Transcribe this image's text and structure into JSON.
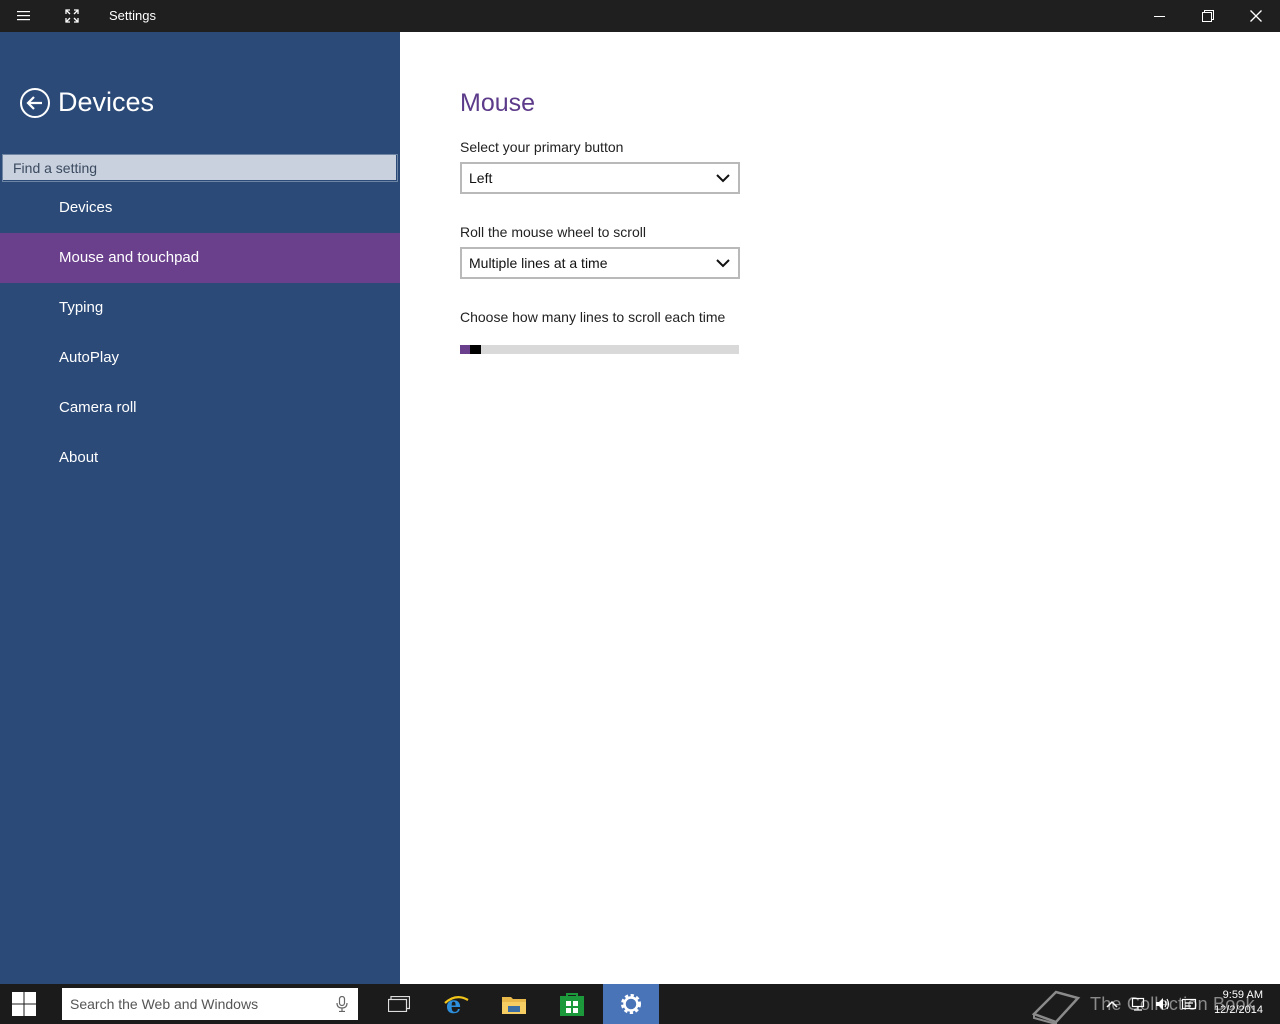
{
  "window": {
    "title": "Settings"
  },
  "sidebar": {
    "title": "Devices",
    "search_placeholder": "Find a setting",
    "items": [
      {
        "label": "Devices",
        "active": false
      },
      {
        "label": "Mouse and touchpad",
        "active": true
      },
      {
        "label": "Typing",
        "active": false
      },
      {
        "label": "AutoPlay",
        "active": false
      },
      {
        "label": "Camera roll",
        "active": false
      },
      {
        "label": "About",
        "active": false
      }
    ]
  },
  "main": {
    "title": "Mouse",
    "primary_button": {
      "label": "Select your primary button",
      "value": "Left"
    },
    "wheel_scroll": {
      "label": "Roll the mouse wheel to scroll",
      "value": "Multiple lines at a time"
    },
    "lines_to_scroll": {
      "label": "Choose how many lines to scroll each time",
      "fraction": 0.02
    }
  },
  "taskbar": {
    "search_placeholder": "Search the Web and Windows",
    "watermark": "The Collection Book",
    "time": "9:59 AM",
    "date": "12/2/2014"
  },
  "colors": {
    "sidebar_bg": "#2b4a78",
    "accent": "#6a3f8c",
    "title_purple": "#5c3b8a",
    "taskbar_active": "#4a74b8"
  }
}
